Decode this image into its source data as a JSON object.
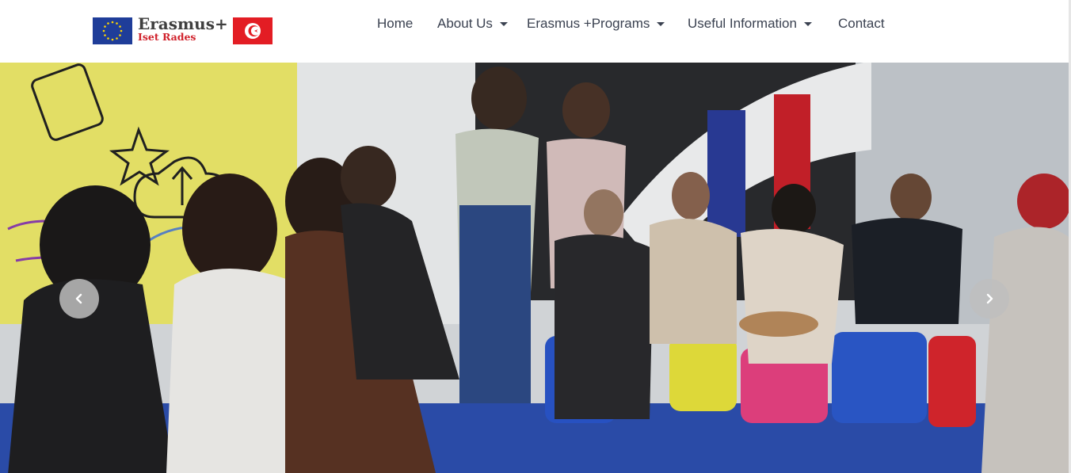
{
  "brand": {
    "title": "Erasmus+",
    "subtitle": "Iset Rades",
    "eu_flag_icon": "eu-flag-icon",
    "tn_flag_icon": "tunisia-flag-icon"
  },
  "nav": {
    "items": [
      {
        "label": "Home",
        "dropdown": false
      },
      {
        "label": "About Us",
        "dropdown": true
      },
      {
        "label": "Erasmus +Programs",
        "dropdown": true
      },
      {
        "label": "Useful Information",
        "dropdown": true
      },
      {
        "label": "Contact",
        "dropdown": false
      }
    ]
  },
  "carousel": {
    "prev_icon": "chevron-left-icon",
    "next_icon": "chevron-right-icon"
  },
  "colors": {
    "brand_red": "#d0202a",
    "eu_blue": "#1f3d99",
    "nav_text": "#3a4150"
  }
}
